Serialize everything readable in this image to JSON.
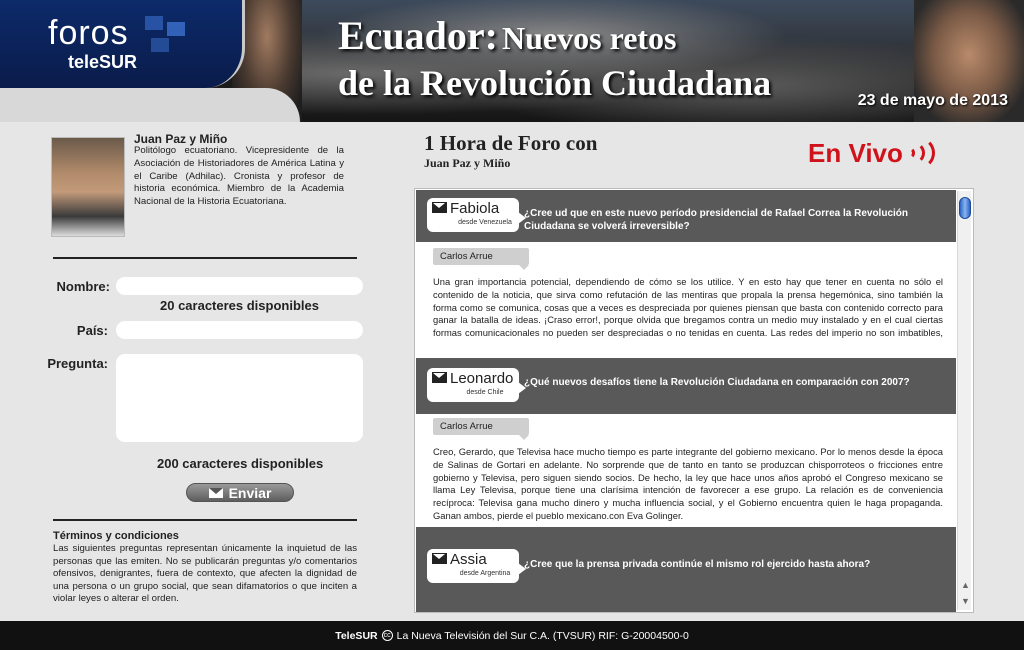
{
  "header": {
    "logo_foros": "foros",
    "logo_brand": "teleSUR",
    "title_word": "Ecuador:",
    "title_rest": "Nuevos retos",
    "title_line2": "de la Revolución Ciudadana",
    "date": "23 de mayo de 2013"
  },
  "speaker": {
    "name": "Juan Paz y Miño",
    "bio": "Politólogo ecuatoriano. Vicepresidente de la Asociación de Historiadores de América Latina y el Caribe (Adhilac). Cronista y profesor de historia económica. Miembro de la Academia Nacional de la Historia Ecuatoriana."
  },
  "form": {
    "name_label": "Nombre:",
    "name_value": "",
    "name_counter": "20 caracteres disponibles",
    "country_label": "País:",
    "country_value": "",
    "question_label": "Pregunta:",
    "question_value": "",
    "question_counter": "200 caracteres disponibles",
    "send_label": "Enviar"
  },
  "terms": {
    "title": "Términos y condiciones",
    "text": "Las siguientes preguntas representan únicamente la inquietud de las personas que las emiten. No se publicarán preguntas y/o comentarios ofensivos, denigrantes, fuera de contexto, que afecten la dignidad de una persona o un grupo social, que sean difamatorios o que inciten a violar leyes o alterar el orden."
  },
  "forum": {
    "title": "1 Hora de Foro con",
    "subtitle": "Juan Paz y Miño",
    "live_label": "En Vivo",
    "live_color": "#d0121b",
    "items": [
      {
        "user": "Fabiola",
        "from": "desde Venezuela",
        "question": "¿Cree ud que en este nuevo período presidencial de Rafael Correa la Revolución Ciudadana se volverá irreversible?",
        "answer_author": "Carlos Arrue",
        "answer": "Una gran importancia potencial, dependiendo de cómo se los utilice. Y en esto hay que tener en cuenta no sólo el contenido de la noticia, que sirva como refutación de las mentiras que propala la prensa hegemónica, sino también la forma como se comunica, cosas que a veces es despreciada por quienes piensan que basta con contenido correcto para ganar la batalla de ideas. ¡Craso error!, porque olvida que bregamos contra un medio muy instalado y en el cual ciertas formas comunicacionales no pueden ser despreciadas o no tenidas en cuenta. Las redes del imperio no son imbatibles, pero no serán derrotadas por mero vountarismo o confiando tan sólo en los contenidos. La agilidad, la rapidez, la"
      },
      {
        "user": "Leonardo",
        "from": "desde Chile",
        "question": "¿Qué nuevos desafíos tiene la Revolución Ciudadana en comparación con 2007?",
        "answer_author": "Carlos Arrue",
        "answer": "Creo, Gerardo, que Televisa hace mucho tiempo es parte integrante del gobierno mexicano. Por lo menos desde la época de Salinas de Gortari en adelante. No sorprende que de tanto en tanto se produzcan chisporroteos o fricciones entre gobierno y Televisa, pero siguen siendo socios. De hecho, la ley que hace unos años aprobó el Congreso mexicano se llama Ley Televisa, porque tiene una clarísima intención de favorecer a ese grupo. La relación es de conveniencia recíproca: Televisa gana mucho dinero y mucha influencia social, y el Gobierno encuentra quien le haga propaganda. Ganan ambos, pierde el pueblo mexicano.con Eva Golinger."
      },
      {
        "user": "Assia",
        "from": "desde Argentina",
        "question": "¿Cree que la prensa privada continúe el mismo rol ejercido hasta ahora?"
      }
    ]
  },
  "footer": {
    "brand": "TeleSUR",
    "text": "La Nueva Televisión del Sur C.A. (TVSUR) RIF: G-20004500-0"
  }
}
